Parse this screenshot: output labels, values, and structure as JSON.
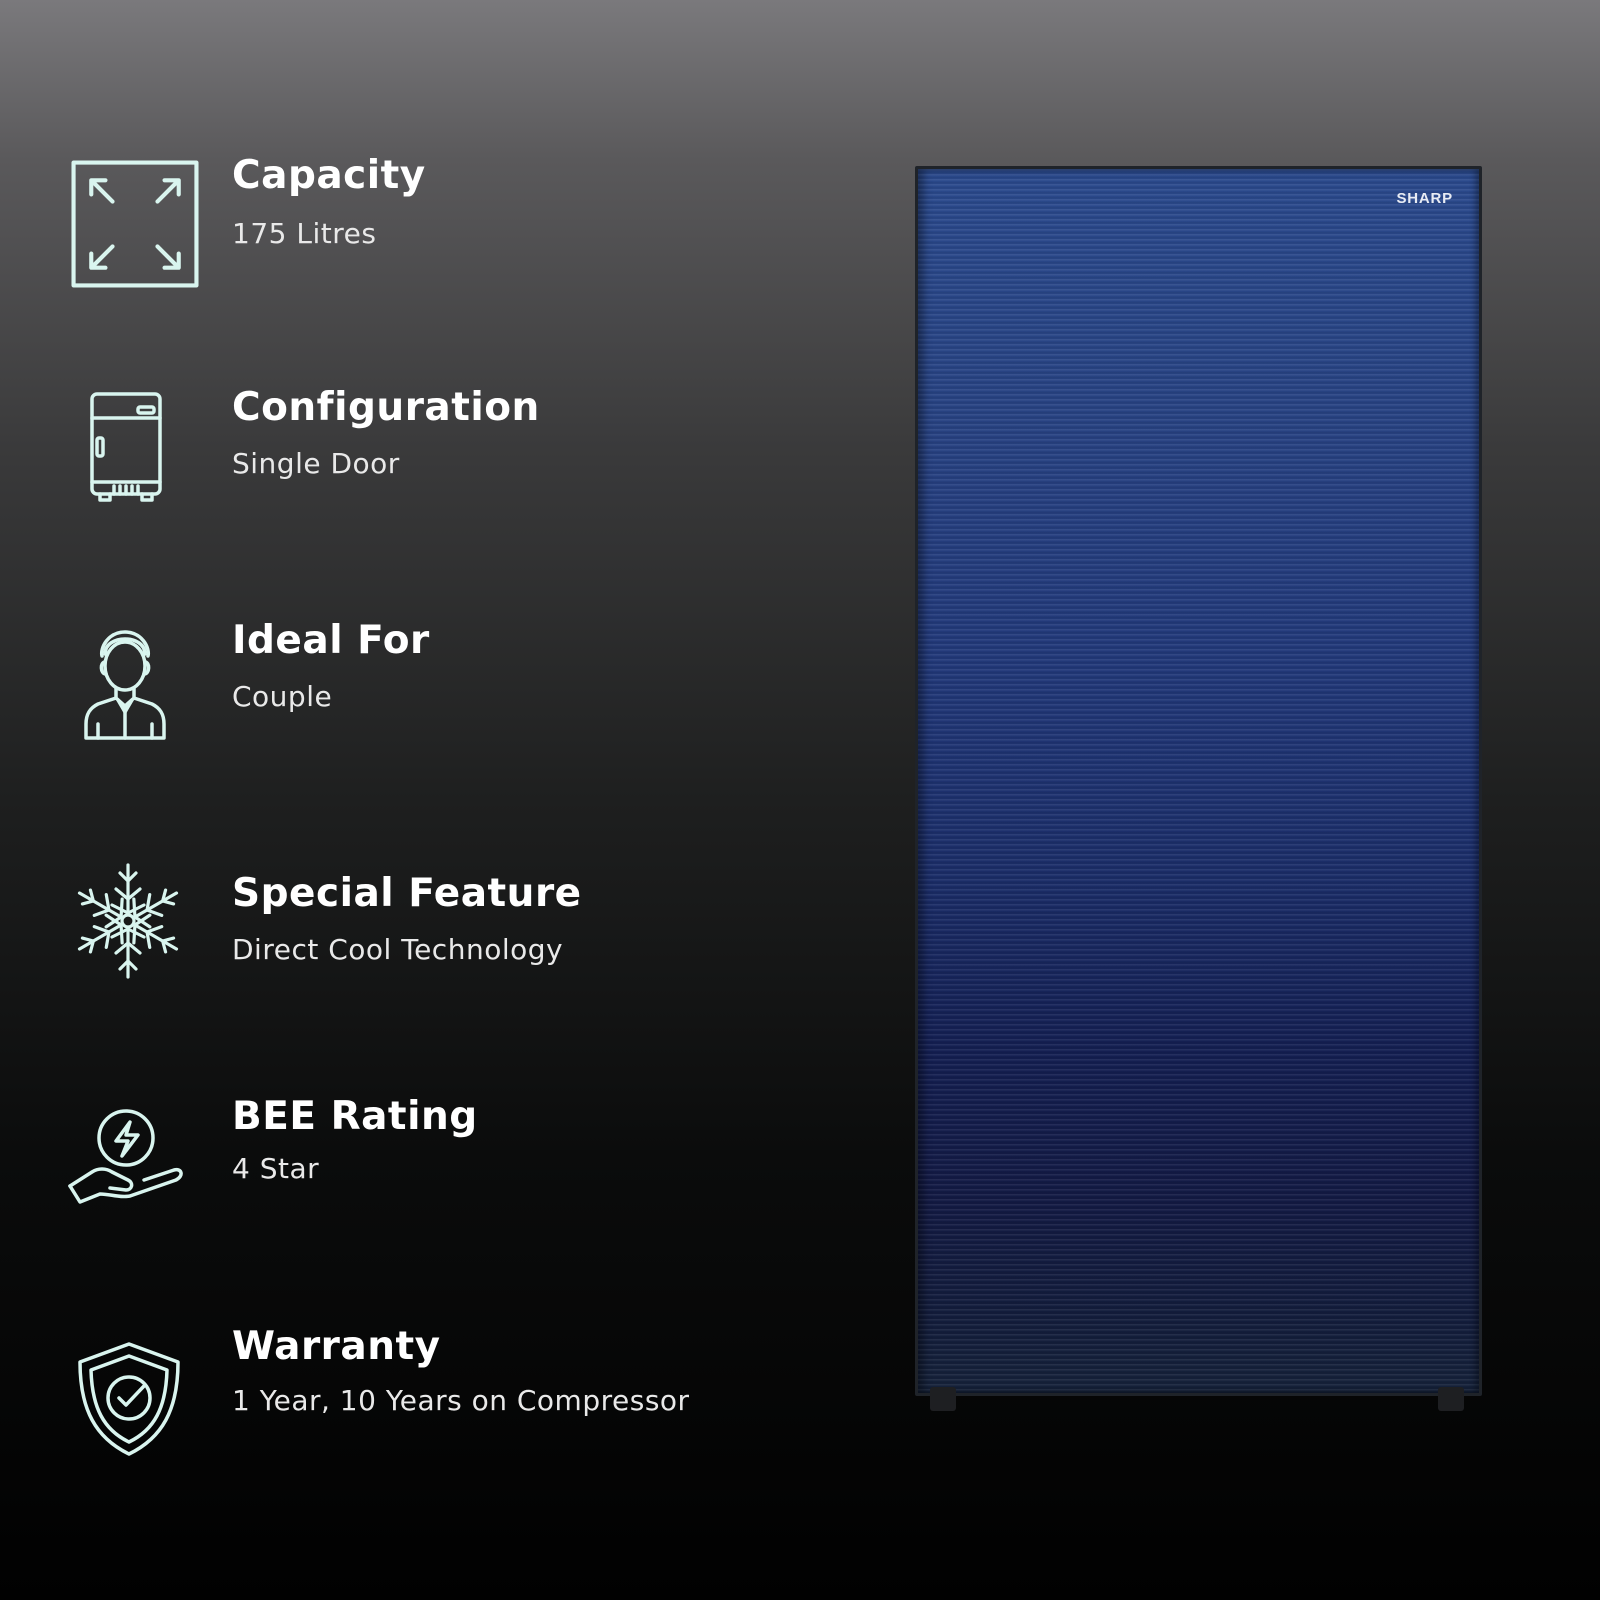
{
  "specs": [
    {
      "icon": "expand-arrows-icon",
      "title": "Capacity",
      "value": "175 Litres"
    },
    {
      "icon": "refrigerator-icon",
      "title": "Configuration",
      "value": "Single Door"
    },
    {
      "icon": "person-icon",
      "title": "Ideal For",
      "value": "Couple"
    },
    {
      "icon": "snowflake-icon",
      "title": "Special Feature",
      "value": "Direct Cool Technology"
    },
    {
      "icon": "energy-hand-icon",
      "title": "BEE Rating",
      "value": "4 Star"
    },
    {
      "icon": "shield-check-icon",
      "title": "Warranty",
      "value": "1 Year, 10 Years on Compressor"
    }
  ],
  "product": {
    "brand": "SHARP",
    "color": "#22397a"
  },
  "colors": {
    "icon_stroke": "#d9f5ef",
    "text": "#ffffff"
  }
}
